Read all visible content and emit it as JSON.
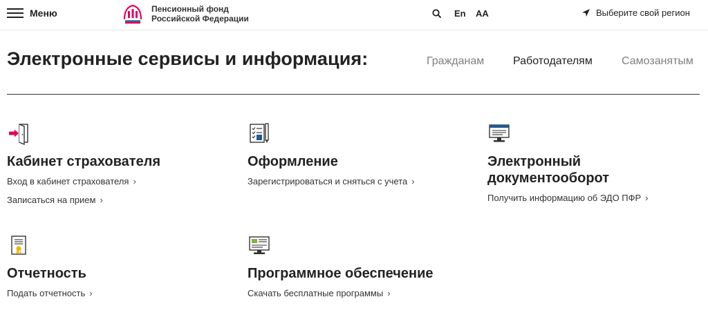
{
  "header": {
    "menu_label": "Меню",
    "logo_line1": "Пенсионный фонд",
    "logo_line2": "Российской Федерации",
    "lang_label": "En",
    "font_size_label": "AA",
    "region_label": "Выберите свой регион"
  },
  "main": {
    "title": "Электронные сервисы и информация:",
    "tabs": [
      {
        "label": "Гражданам",
        "active": false
      },
      {
        "label": "Работодателям",
        "active": true
      },
      {
        "label": "Самозанятым",
        "active": false
      }
    ]
  },
  "services": [
    {
      "title": "Кабинет страхователя",
      "icon": "login-door-icon",
      "links": [
        "Вход в кабинет страхователя",
        "Записаться на прием"
      ]
    },
    {
      "title": "Оформление",
      "icon": "registration-form-icon",
      "links": [
        "Зарегистрироваться и сняться с учета"
      ]
    },
    {
      "title_line1": "Электронный",
      "title_line2": "документооборот",
      "icon": "monitor-document-icon",
      "links": [
        "Получить информацию об ЭДО ПФР"
      ]
    },
    {
      "title": "Отчетность",
      "icon": "certificate-icon",
      "links": [
        "Подать отчетность"
      ]
    },
    {
      "title": "Программное обеспечение",
      "icon": "software-monitor-icon",
      "links": [
        "Скачать бесплатные программы"
      ]
    }
  ],
  "colors": {
    "text": "#222222",
    "muted_tab": "#808080",
    "accent_pink": "#e4005a",
    "accent_blue": "#1f5a96",
    "accent_yellow": "#f2b500"
  }
}
